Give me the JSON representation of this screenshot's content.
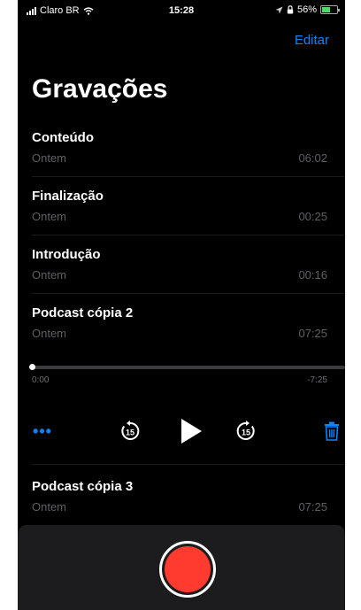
{
  "status_bar": {
    "carrier": "Claro BR",
    "time": "15:28",
    "battery": "56%",
    "battery_level": 0.56
  },
  "header": {
    "edit_label": "Editar",
    "title": "Gravações"
  },
  "recordings": [
    {
      "name": "Conteúdo",
      "date": "Ontem",
      "duration": "06:02"
    },
    {
      "name": "Finalização",
      "date": "Ontem",
      "duration": "00:25"
    },
    {
      "name": "Introdução",
      "date": "Ontem",
      "duration": "00:16"
    },
    {
      "name": "Podcast cópia 2",
      "date": "Ontem",
      "duration": "07:25"
    },
    {
      "name": "Podcast cópia 3",
      "date": "Ontem",
      "duration": "07:25"
    }
  ],
  "player": {
    "current_time": "0:00",
    "remaining_time": "-7:25",
    "progress": 0.0,
    "more_label": "•••",
    "skip_back_seconds": "15",
    "skip_forward_seconds": "15"
  },
  "colors": {
    "accent": "#0a84ff",
    "record": "#ff3b30",
    "background": "#000000"
  },
  "icons": [
    "wifi-icon",
    "location-icon",
    "lock-icon",
    "battery-icon",
    "skip-back-icon",
    "play-icon",
    "skip-forward-icon",
    "trash-icon",
    "record-icon"
  ]
}
